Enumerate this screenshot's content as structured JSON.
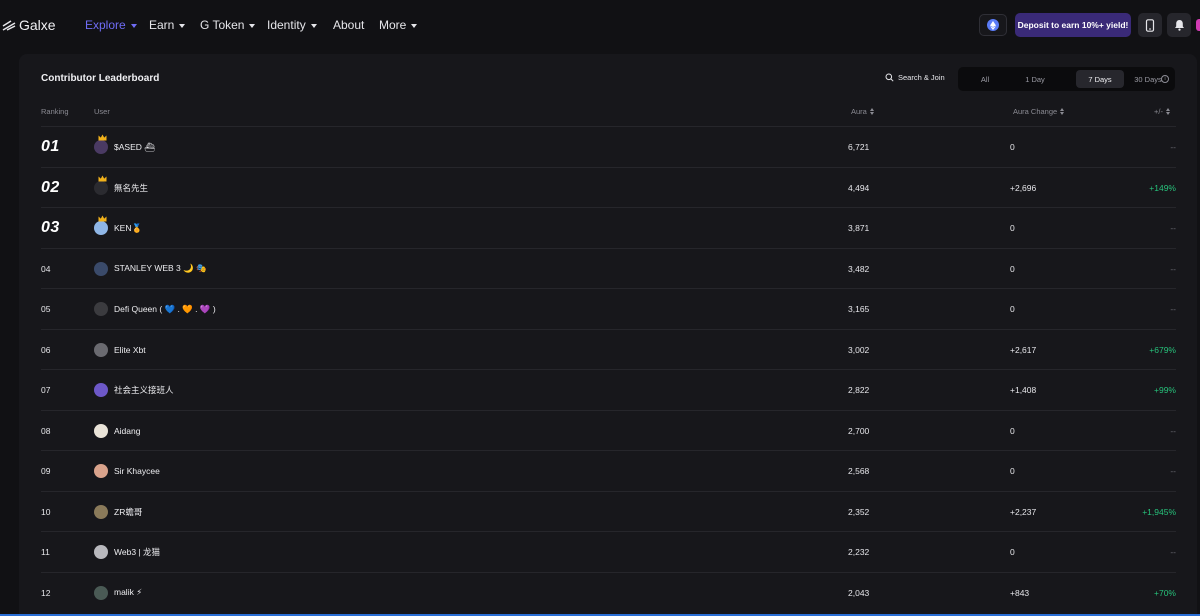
{
  "nav": {
    "logo_text": "Galxe",
    "items": [
      {
        "label": "Explore",
        "caret": true
      },
      {
        "label": "Earn",
        "caret": true
      },
      {
        "label": "G Token",
        "caret": true
      },
      {
        "label": "Identity",
        "caret": true
      },
      {
        "label": "About",
        "caret": false
      },
      {
        "label": "More",
        "caret": true
      }
    ],
    "active_index": 0,
    "deposit_label": "Deposit to earn 10%+ yield!"
  },
  "leaderboard": {
    "title": "Contributor Leaderboard",
    "search_label": "Search & Join",
    "periods": [
      "All",
      "1 Day",
      "7 Days",
      "30 Days"
    ],
    "active_period": "7 Days",
    "columns": {
      "ranking": "Ranking",
      "user": "User",
      "aura": "Aura",
      "aura_change": "Aura Change",
      "pct": "+/-"
    },
    "rows": [
      {
        "rank": "01",
        "name": "$ASED ⛴",
        "aura": "6,721",
        "change": "0",
        "pct": "--",
        "avatar_color": "#4a3a63",
        "crown": true
      },
      {
        "rank": "02",
        "name": "無名先生",
        "aura": "4,494",
        "change": "+2,696",
        "pct": "+149%",
        "avatar_color": "#2b2b30",
        "crown": true
      },
      {
        "rank": "03",
        "name": "KEN🏅",
        "aura": "3,871",
        "change": "0",
        "pct": "--",
        "avatar_color": "#8fb6e6",
        "crown": true
      },
      {
        "rank": "04",
        "name": "STANLEY WEB 3 🌙 🎭",
        "aura": "3,482",
        "change": "0",
        "pct": "--",
        "avatar_color": "#3a4a6a",
        "crown": false
      },
      {
        "rank": "05",
        "name": "Defi Queen ( 💙 . 🧡 . 💜 )",
        "aura": "3,165",
        "change": "0",
        "pct": "--",
        "avatar_color": "#3b3b3f",
        "crown": false
      },
      {
        "rank": "06",
        "name": "Elite Xbt",
        "aura": "3,002",
        "change": "+2,617",
        "pct": "+679%",
        "avatar_color": "#6a6a70",
        "crown": false
      },
      {
        "rank": "07",
        "name": "社会主义接班人",
        "aura": "2,822",
        "change": "+1,408",
        "pct": "+99%",
        "avatar_color": "#6d58c8",
        "crown": false
      },
      {
        "rank": "08",
        "name": "Aidang",
        "aura": "2,700",
        "change": "0",
        "pct": "--",
        "avatar_color": "#e9e3d8",
        "crown": false
      },
      {
        "rank": "09",
        "name": "Sir Khaycee",
        "aura": "2,568",
        "change": "0",
        "pct": "--",
        "avatar_color": "#d9a38c",
        "crown": false
      },
      {
        "rank": "10",
        "name": "ZR蟾哥",
        "aura": "2,352",
        "change": "+2,237",
        "pct": "+1,945%",
        "avatar_color": "#8a7a5a",
        "crown": false
      },
      {
        "rank": "11",
        "name": "Web3 | 龙猫",
        "aura": "2,232",
        "change": "0",
        "pct": "--",
        "avatar_color": "#b9b9be",
        "crown": false
      },
      {
        "rank": "12",
        "name": "malik ⚡",
        "aura": "2,043",
        "change": "+843",
        "pct": "+70%",
        "avatar_color": "#4a5a55",
        "crown": false
      }
    ]
  },
  "colors": {
    "accent": "#6f6cf5",
    "positive": "#27c27b",
    "deposit_bg": "#3a2a78"
  }
}
